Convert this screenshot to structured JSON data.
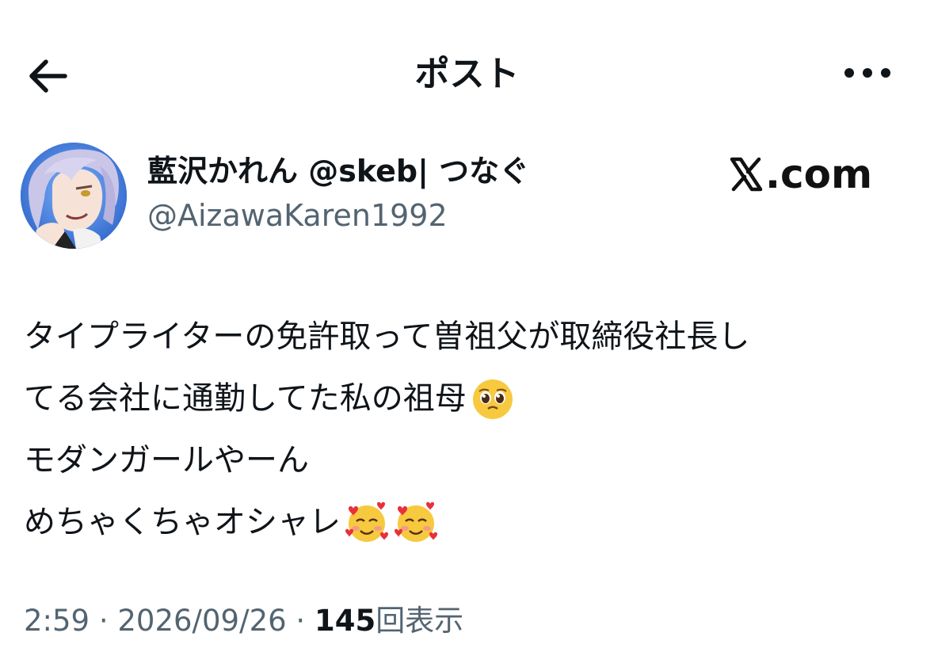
{
  "header": {
    "title": "ポスト",
    "back_icon": "arrow-left-icon",
    "more_icon": "more-horizontal-icon"
  },
  "author": {
    "display_name": "藍沢かれん @skeb| つなぐ",
    "handle": "@AizawaKaren1992",
    "avatar": "anime-character-avatar"
  },
  "watermark": {
    "brand": "X.com",
    "suffix": ".com"
  },
  "post": {
    "lines": [
      "タイプライターの免許取って曽祖父が取締役社長し",
      "てる会社に通勤してた私の祖母",
      "モダンガールやーん",
      "めちゃくちゃオシャレ"
    ],
    "emojis": {
      "line2": "pleading-face-emoji",
      "line4": [
        "smiling-face-with-hearts-emoji",
        "smiling-face-with-hearts-emoji"
      ]
    }
  },
  "meta": {
    "time": "2:59",
    "sep1": " · ",
    "date": "2026/09/26",
    "sep2": " · ",
    "views": "145",
    "views_label": "回表示"
  },
  "colors": {
    "text_primary": "#0f1419",
    "text_secondary": "#536471",
    "background": "#ffffff"
  }
}
